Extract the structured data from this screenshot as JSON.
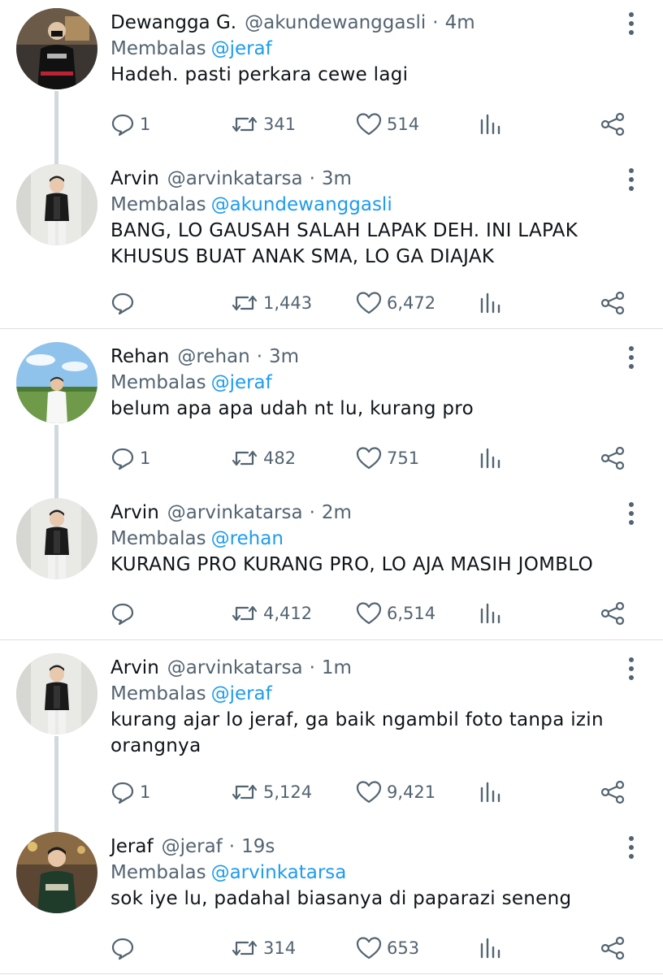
{
  "threads": [
    {
      "tweets": [
        {
          "name": "Dewangga G.",
          "handle": "@akundewanggasli",
          "time": "4m",
          "replying_label": "Membalas",
          "replying_to": "@jeraf",
          "lines": [
            "Hadeh. pasti perkara cewe lagi"
          ],
          "replies": "1",
          "retweets": "341",
          "likes": "514"
        },
        {
          "name": "Arvin",
          "handle": "@arvinkatarsa",
          "time": "3m",
          "replying_label": "Membalas",
          "replying_to": "@akundewanggasli",
          "lines": [
            "BANG, LO GAUSAH SALAH LAPAK DEH. INI LAPAK",
            "KHUSUS BUAT ANAK SMA, LO GA DIAJAK"
          ],
          "replies": "",
          "retweets": "1,443",
          "likes": "6,472"
        }
      ]
    },
    {
      "tweets": [
        {
          "name": "Rehan",
          "handle": "@rehan",
          "time": "3m",
          "replying_label": "Membalas",
          "replying_to": "@jeraf",
          "lines": [
            "belum apa apa udah nt lu, kurang pro"
          ],
          "replies": "1",
          "retweets": "482",
          "likes": "751"
        },
        {
          "name": "Arvin",
          "handle": "@arvinkatarsa",
          "time": "2m",
          "replying_label": "Membalas",
          "replying_to": "@rehan",
          "lines": [
            "KURANG PRO KURANG PRO, LO AJA MASIH JOMBLO"
          ],
          "replies": "",
          "retweets": "4,412",
          "likes": "6,514"
        }
      ]
    },
    {
      "tweets": [
        {
          "name": "Arvin",
          "handle": "@arvinkatarsa",
          "time": "1m",
          "replying_label": "Membalas",
          "replying_to": "@jeraf",
          "lines": [
            "kurang ajar lo jeraf, ga baik ngambil foto tanpa izin",
            "orangnya"
          ],
          "replies": "1",
          "retweets": "5,124",
          "likes": "9,421"
        },
        {
          "name": "Jeraf",
          "handle": "@jeraf",
          "time": "19s",
          "replying_label": "Membalas",
          "replying_to": "@arvinkatarsa",
          "lines": [
            "sok iye lu, padahal biasanya di paparazi seneng"
          ],
          "replies": "",
          "retweets": "314",
          "likes": "653"
        }
      ]
    }
  ],
  "separator": "·",
  "icons": {
    "reply": "reply-bubble-icon",
    "retweet": "retweet-icon",
    "like": "heart-icon",
    "views": "views-bar-icon",
    "share": "share-icon",
    "more": "more-vertical-icon"
  },
  "colors": {
    "mention": "#1d9bf0",
    "muted": "#536471",
    "text": "#0f1419",
    "connector": "#cfd9de",
    "divider": "#dcdfe2"
  }
}
